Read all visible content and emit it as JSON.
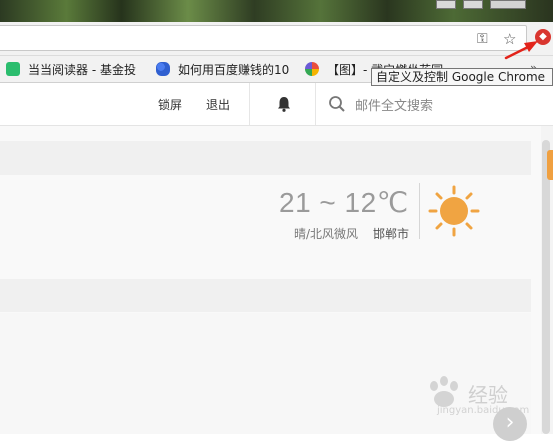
{
  "addressbar": {
    "extension_badge": "◆"
  },
  "bookmarks": [
    {
      "label": "当当阅读器 - 基金投"
    },
    {
      "label": "如何用百度赚钱的10"
    },
    {
      "label": "【图】- 武宁燃坐花园"
    }
  ],
  "bookmarks_more": "»",
  "tooltip": "自定义及控制 Google Chrome",
  "header": {
    "lock_label": "锁屏",
    "exit_label": "退出",
    "search_placeholder": "邮件全文搜索"
  },
  "weather": {
    "temperature": "21 ~ 12℃",
    "description": "晴/北风微风",
    "city": "邯郸市",
    "icon": "sun-icon"
  },
  "watermark": {
    "brand": "经验",
    "url": "jingyan.baidu.com"
  },
  "next_label": "›",
  "colors": {
    "sun": "#f0a442",
    "arrow": "#e2231a",
    "extension": "#d9362f"
  }
}
